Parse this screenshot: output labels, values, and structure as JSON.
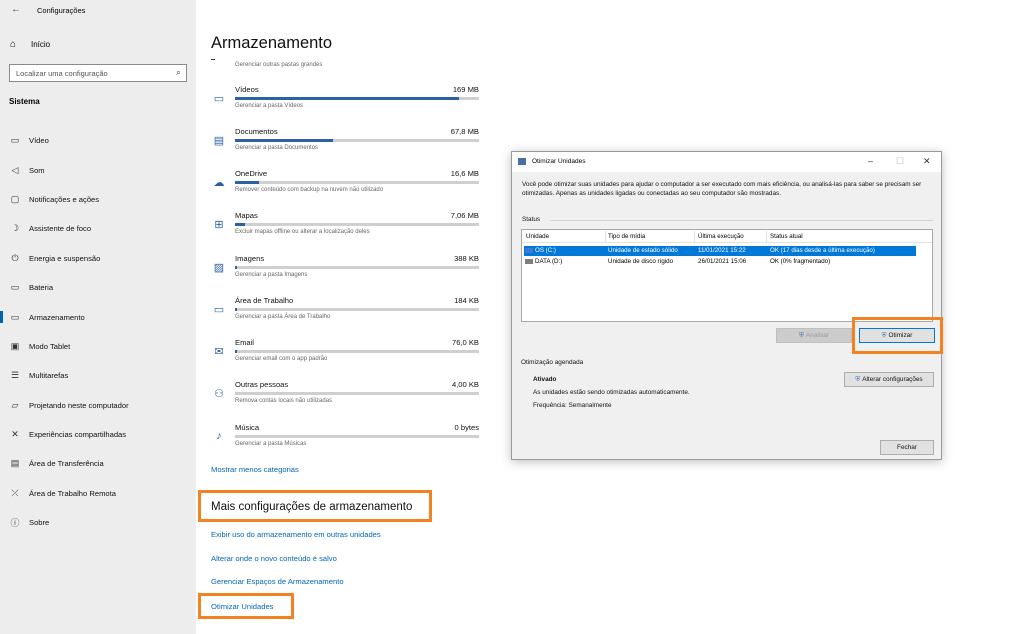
{
  "window": {
    "title": "Configurações"
  },
  "sidebar": {
    "home": "Início",
    "search_placeholder": "Localizar uma configuração",
    "section": "Sistema",
    "items": [
      {
        "label": "Vídeo",
        "icon": "monitor-icon"
      },
      {
        "label": "Som",
        "icon": "speaker-icon"
      },
      {
        "label": "Notificações e ações",
        "icon": "notification-icon"
      },
      {
        "label": "Assistente de foco",
        "icon": "moon-icon"
      },
      {
        "label": "Energia e suspensão",
        "icon": "power-icon"
      },
      {
        "label": "Bateria",
        "icon": "battery-icon"
      },
      {
        "label": "Armazenamento",
        "icon": "storage-icon",
        "active": true
      },
      {
        "label": "Modo Tablet",
        "icon": "tablet-icon"
      },
      {
        "label": "Multitarefas",
        "icon": "multitask-icon"
      },
      {
        "label": "Projetando neste computador",
        "icon": "project-icon"
      },
      {
        "label": "Experiências compartilhadas",
        "icon": "share-icon"
      },
      {
        "label": "Área de Transferência",
        "icon": "clipboard-icon"
      },
      {
        "label": "Área de Trabalho Remota",
        "icon": "remote-icon"
      },
      {
        "label": "Sobre",
        "icon": "info-icon"
      }
    ]
  },
  "main": {
    "title": "Armazenamento",
    "top_desc": "Gerenciar outras pastas grandes",
    "categories": [
      {
        "name": "Vídeos",
        "size": "169 MB",
        "desc": "Gerenciar a pasta Vídeos",
        "fill": 0.92
      },
      {
        "name": "Documentos",
        "size": "67,8 MB",
        "desc": "Gerenciar a pasta Documentos",
        "fill": 0.4
      },
      {
        "name": "OneDrive",
        "size": "16,6 MB",
        "desc": "Remover conteúdo com backup na nuvem não utilizado",
        "fill": 0.1
      },
      {
        "name": "Mapas",
        "size": "7,06 MB",
        "desc": "Excluir mapas offline ou alterar a localização deles",
        "fill": 0.04
      },
      {
        "name": "Imagens",
        "size": "388 KB",
        "desc": "Gerenciar a pasta Imagens",
        "fill": 0.01
      },
      {
        "name": "Área de Trabalho",
        "size": "184 KB",
        "desc": "Gerenciar a pasta Área de Trabalho",
        "fill": 0.01
      },
      {
        "name": "Email",
        "size": "76,0 KB",
        "desc": "Gerenciar email com o app padrão",
        "fill": 0.01
      },
      {
        "name": "Outras pessoas",
        "size": "4,00 KB",
        "desc": "Remova contas locais não utilizadas",
        "fill": 0.0
      },
      {
        "name": "Música",
        "size": "0 bytes",
        "desc": "Gerenciar a pasta Músicas",
        "fill": 0.0
      }
    ],
    "show_less": "Mostrar menos categorias",
    "more_title": "Mais configurações de armazenamento",
    "links": [
      "Exibir uso do armazenamento em outras unidades",
      "Alterar onde o novo conteúdo é salvo",
      "Gerenciar Espaços de Armazenamento"
    ],
    "optimize_link": "Otimizar Unidades"
  },
  "dialog": {
    "title": "Otimizar Unidades",
    "description": "Você pode otimizar suas unidades para ajudar o computador a ser executado com mais eficiência, ou analisá-las para saber se precisam ser otimizadas. Apenas as unidades ligadas ou conectadas ao seu computador são mostradas.",
    "status_label": "Status",
    "columns": [
      "Unidade",
      "Tipo de mídia",
      "Última execução",
      "Status atual"
    ],
    "drives": [
      {
        "unit": "OS (C:)",
        "media": "Unidade de estado sólido",
        "last": "11/01/2021 15:22",
        "status": "OK (17 dias desde a última execução)",
        "selected": true
      },
      {
        "unit": "DATA (D:)",
        "media": "Unidade de disco rígido",
        "last": "26/01/2021 15:06",
        "status": "OK (0% fragmentado)",
        "selected": false
      }
    ],
    "analyze_button": "Analisar",
    "optimize_button": "Otimizar",
    "scheduled_label": "Otimização agendada",
    "scheduled_state": "Ativado",
    "scheduled_desc": "As unidades estão sendo otimizadas automaticamente.",
    "frequency": "Frequência: Semanalmente",
    "change_settings_button": "Alterar configurações",
    "close_button": "Fechar"
  },
  "colors": {
    "accent": "#0067b8",
    "highlight": "#f58220",
    "selection": "#0078d7"
  }
}
